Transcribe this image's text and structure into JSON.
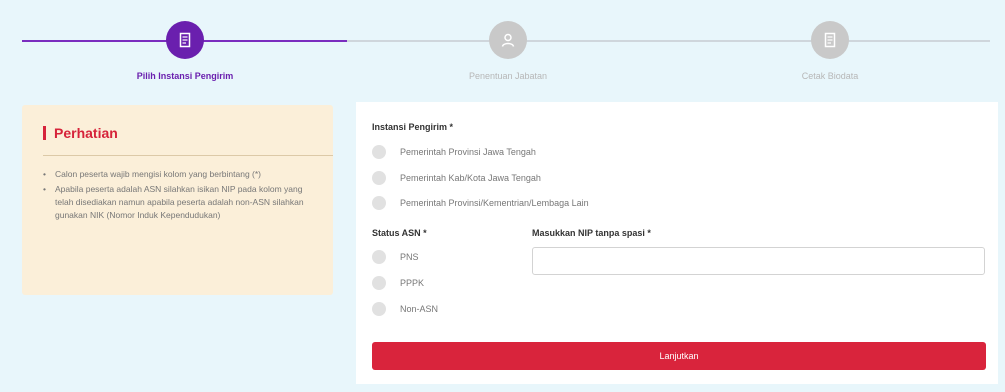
{
  "stepper": {
    "steps": [
      {
        "label": "Pilih Instansi Pengirim",
        "state": "active",
        "icon": "document-icon"
      },
      {
        "label": "Penentuan Jabatan",
        "state": "inactive",
        "icon": "person-icon"
      },
      {
        "label": "Cetak Biodata",
        "state": "inactive",
        "icon": "document-icon"
      }
    ],
    "colors": {
      "active": "#6a1fae",
      "inactive": "#c9c9c9"
    }
  },
  "notice": {
    "title": "Perhatian",
    "items": [
      "Calon peserta wajib mengisi kolom yang berbintang (*)",
      "Apabila peserta adalah ASN silahkan isikan NIP pada kolom yang telah disediakan namun apabila peserta adalah non-ASN silahkan gunakan NIK (Nomor Induk Kependudukan)"
    ]
  },
  "form": {
    "instansi": {
      "label": "Instansi Pengirim *",
      "options": [
        "Pemerintah Provinsi Jawa Tengah",
        "Pemerintah Kab/Kota Jawa Tengah",
        "Pemerintah Provinsi/Kementrian/Lembaga Lain"
      ]
    },
    "status_asn": {
      "label": "Status ASN *",
      "options": [
        "PNS",
        "PPPK",
        "Non-ASN"
      ]
    },
    "nip": {
      "label": "Masukkan NIP tanpa spasi *",
      "value": "",
      "placeholder": ""
    },
    "submit_label": "Lanjutkan",
    "accent": "#d9243c"
  }
}
